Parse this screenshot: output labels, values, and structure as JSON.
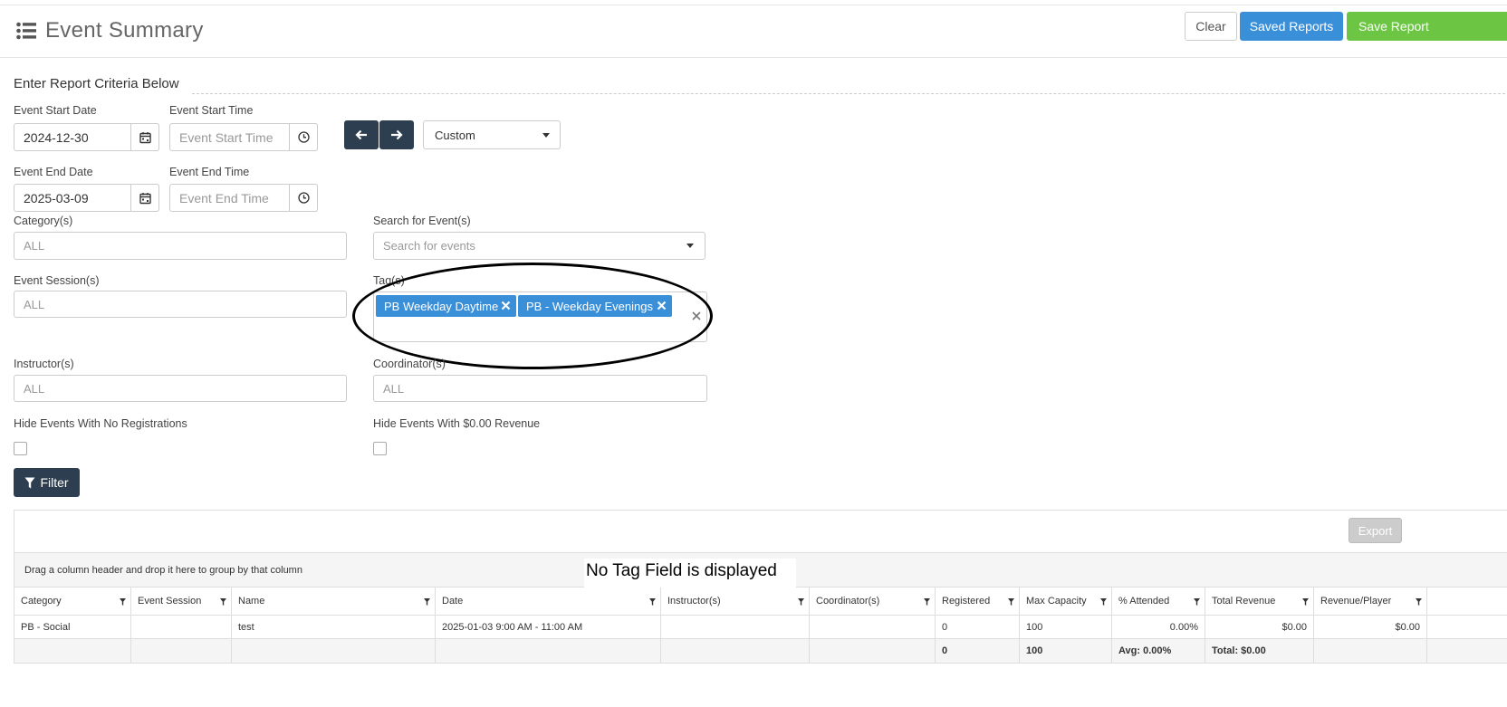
{
  "header": {
    "title": "Event Summary",
    "clear_label": "Clear",
    "saved_reports_label": "Saved Reports",
    "save_report_label": "Save Report"
  },
  "criteria": {
    "section_title": "Enter Report Criteria Below",
    "start_date_label": "Event Start Date",
    "start_date_value": "2024-12-30",
    "start_time_label": "Event Start Time",
    "start_time_placeholder": "Event Start Time",
    "end_date_label": "Event End Date",
    "end_date_value": "2025-03-09",
    "end_time_label": "Event End Time",
    "end_time_placeholder": "Event End Time",
    "range_select_value": "Custom",
    "category_label": "Category(s)",
    "category_placeholder": "ALL",
    "search_events_label": "Search for Event(s)",
    "search_events_placeholder": "Search for events",
    "session_label": "Event Session(s)",
    "session_placeholder": "ALL",
    "tags_label": "Tag(s)",
    "tags": [
      "PB Weekday Daytime",
      "PB - Weekday Evenings"
    ],
    "instructor_label": "Instructor(s)",
    "instructor_placeholder": "ALL",
    "coordinator_label": "Coordinator(s)",
    "coordinator_placeholder": "ALL",
    "hide_no_reg_label": "Hide Events With No Registrations",
    "hide_zero_rev_label": "Hide Events With $0.00 Revenue",
    "filter_label": "Filter"
  },
  "grid": {
    "export_label": "Export",
    "group_hint": "Drag a column header and drop it here to group by that column",
    "annotation": "No Tag Field is displayed",
    "columns": [
      "Category",
      "Event Session",
      "Name",
      "Date",
      "Instructor(s)",
      "Coordinator(s)",
      "Registered",
      "Max Capacity",
      "% Attended",
      "Total Revenue",
      "Revenue/Player"
    ],
    "rows": [
      [
        "PB - Social",
        "",
        "test",
        "2025-01-03 9:00 AM - 11:00 AM",
        "",
        "",
        "0",
        "100",
        "0.00%",
        "$0.00",
        "$0.00"
      ]
    ],
    "footer": [
      "",
      "",
      "",
      "",
      "",
      "",
      "0",
      "100",
      "Avg: 0.00%",
      "Total: $0.00",
      ""
    ]
  }
}
